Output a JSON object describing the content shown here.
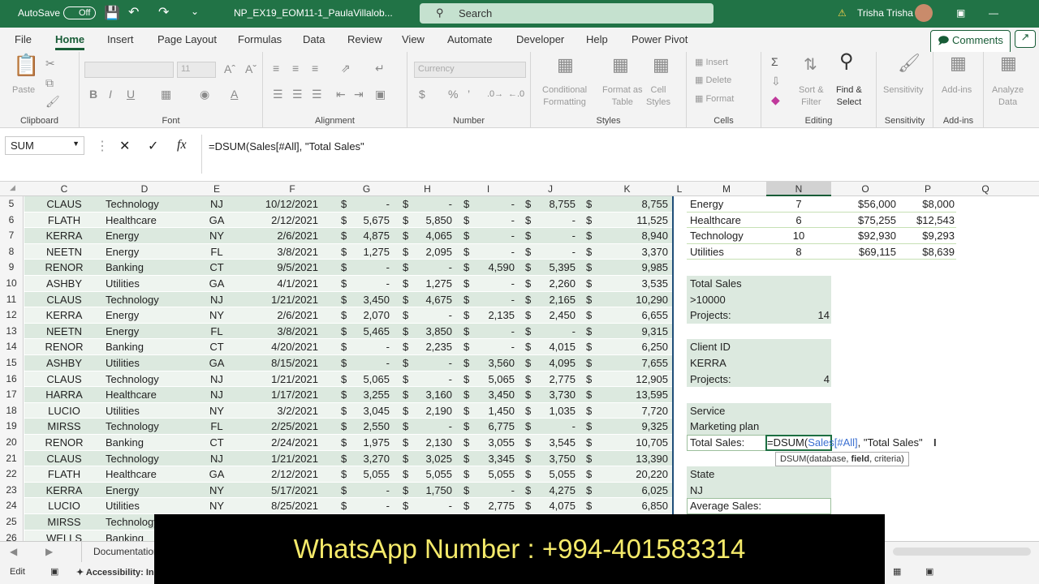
{
  "titlebar": {
    "autosave": "AutoSave",
    "toggle": "Off",
    "filename": "NP_EX19_EOM11-1_PaulaVillalob...",
    "search_placeholder": "Search",
    "user": "Trisha Trisha"
  },
  "tabs": [
    "File",
    "Home",
    "Insert",
    "Page Layout",
    "Formulas",
    "Data",
    "Review",
    "View",
    "Automate",
    "Developer",
    "Help",
    "Power Pivot"
  ],
  "active_tab": "Home",
  "comments_label": "Comments",
  "ribbon": {
    "clipboard": "Clipboard",
    "paste": "Paste",
    "font": "Font",
    "font_size": "11",
    "alignment": "Alignment",
    "number": "Number",
    "number_format": "Currency",
    "styles": "Styles",
    "cond_fmt": [
      "Conditional",
      "Formatting"
    ],
    "format_table": [
      "Format as",
      "Table"
    ],
    "cell_styles": [
      "Cell",
      "Styles"
    ],
    "cells": "Cells",
    "insert": "Insert",
    "delete": "Delete",
    "format": "Format",
    "editing": "Editing",
    "sort": [
      "Sort &",
      "Filter"
    ],
    "find": [
      "Find &",
      "Select"
    ],
    "sensitivity_grp": "Sensitivity",
    "sensitivity": "Sensitivity",
    "addins_grp": "Add-ins",
    "addins": "Add-ins",
    "analyze": [
      "Analyze",
      "Data"
    ]
  },
  "namebox": "SUM",
  "formula": "=DSUM(Sales[#All], \"Total Sales\"",
  "columns": [
    "C",
    "D",
    "E",
    "F",
    "G",
    "H",
    "I",
    "J",
    "K",
    "L",
    "M",
    "N",
    "O",
    "P",
    "Q"
  ],
  "rows": [
    {
      "n": "5",
      "c": "CLAUS",
      "d": "Technology",
      "e": "NJ",
      "f": "10/12/2021",
      "g": "-",
      "h": "-",
      "i": "-",
      "j": "8,755",
      "k": "8,755"
    },
    {
      "n": "6",
      "c": "FLATH",
      "d": "Healthcare",
      "e": "GA",
      "f": "2/12/2021",
      "g": "5,675",
      "h": "5,850",
      "i": "-",
      "j": "-",
      "k": "11,525"
    },
    {
      "n": "7",
      "c": "KERRA",
      "d": "Energy",
      "e": "NY",
      "f": "2/6/2021",
      "g": "4,875",
      "h": "4,065",
      "i": "-",
      "j": "-",
      "k": "8,940"
    },
    {
      "n": "8",
      "c": "NEETN",
      "d": "Energy",
      "e": "FL",
      "f": "3/8/2021",
      "g": "1,275",
      "h": "2,095",
      "i": "-",
      "j": "-",
      "k": "3,370"
    },
    {
      "n": "9",
      "c": "RENOR",
      "d": "Banking",
      "e": "CT",
      "f": "9/5/2021",
      "g": "-",
      "h": "-",
      "i": "4,590",
      "j": "5,395",
      "k": "9,985"
    },
    {
      "n": "10",
      "c": "ASHBY",
      "d": "Utilities",
      "e": "GA",
      "f": "4/1/2021",
      "g": "-",
      "h": "1,275",
      "i": "-",
      "j": "2,260",
      "k": "3,535"
    },
    {
      "n": "11",
      "c": "CLAUS",
      "d": "Technology",
      "e": "NJ",
      "f": "1/21/2021",
      "g": "3,450",
      "h": "4,675",
      "i": "-",
      "j": "2,165",
      "k": "10,290"
    },
    {
      "n": "12",
      "c": "KERRA",
      "d": "Energy",
      "e": "NY",
      "f": "2/6/2021",
      "g": "2,070",
      "h": "-",
      "i": "2,135",
      "j": "2,450",
      "k": "6,655"
    },
    {
      "n": "13",
      "c": "NEETN",
      "d": "Energy",
      "e": "FL",
      "f": "3/8/2021",
      "g": "5,465",
      "h": "3,850",
      "i": "-",
      "j": "-",
      "k": "9,315"
    },
    {
      "n": "14",
      "c": "RENOR",
      "d": "Banking",
      "e": "CT",
      "f": "4/20/2021",
      "g": "-",
      "h": "2,235",
      "i": "-",
      "j": "4,015",
      "k": "6,250"
    },
    {
      "n": "15",
      "c": "ASHBY",
      "d": "Utilities",
      "e": "GA",
      "f": "8/15/2021",
      "g": "-",
      "h": "-",
      "i": "3,560",
      "j": "4,095",
      "k": "7,655"
    },
    {
      "n": "16",
      "c": "CLAUS",
      "d": "Technology",
      "e": "NJ",
      "f": "1/21/2021",
      "g": "5,065",
      "h": "-",
      "i": "5,065",
      "j": "2,775",
      "k": "12,905"
    },
    {
      "n": "17",
      "c": "HARRA",
      "d": "Healthcare",
      "e": "NJ",
      "f": "1/17/2021",
      "g": "3,255",
      "h": "3,160",
      "i": "3,450",
      "j": "3,730",
      "k": "13,595"
    },
    {
      "n": "18",
      "c": "LUCIO",
      "d": "Utilities",
      "e": "NY",
      "f": "3/2/2021",
      "g": "3,045",
      "h": "2,190",
      "i": "1,450",
      "j": "1,035",
      "k": "7,720"
    },
    {
      "n": "19",
      "c": "MIRSS",
      "d": "Technology",
      "e": "FL",
      "f": "2/25/2021",
      "g": "2,550",
      "h": "-",
      "i": "6,775",
      "j": "-",
      "k": "9,325"
    },
    {
      "n": "20",
      "c": "RENOR",
      "d": "Banking",
      "e": "CT",
      "f": "2/24/2021",
      "g": "1,975",
      "h": "2,130",
      "i": "3,055",
      "j": "3,545",
      "k": "10,705"
    },
    {
      "n": "21",
      "c": "CLAUS",
      "d": "Technology",
      "e": "NJ",
      "f": "1/21/2021",
      "g": "3,270",
      "h": "3,025",
      "i": "3,345",
      "j": "3,750",
      "k": "13,390"
    },
    {
      "n": "22",
      "c": "FLATH",
      "d": "Healthcare",
      "e": "GA",
      "f": "2/12/2021",
      "g": "5,055",
      "h": "5,055",
      "i": "5,055",
      "j": "5,055",
      "k": "20,220"
    },
    {
      "n": "23",
      "c": "KERRA",
      "d": "Energy",
      "e": "NY",
      "f": "5/17/2021",
      "g": "-",
      "h": "1,750",
      "i": "-",
      "j": "4,275",
      "k": "6,025"
    },
    {
      "n": "24",
      "c": "LUCIO",
      "d": "Utilities",
      "e": "NY",
      "f": "8/25/2021",
      "g": "-",
      "h": "-",
      "i": "2,775",
      "j": "4,075",
      "k": "6,850"
    },
    {
      "n": "25",
      "c": "MIRSS",
      "d": "Technology",
      "e": "",
      "f": "",
      "g": "",
      "h": "",
      "i": "",
      "j": "",
      "k": ""
    },
    {
      "n": "26",
      "c": "WELLS",
      "d": "Banking",
      "e": "",
      "f": "",
      "g": "",
      "h": "",
      "i": "",
      "j": "",
      "k": ""
    }
  ],
  "summary": [
    {
      "m": "Energy",
      "n": "7",
      "o": "$56,000",
      "p": "$8,000"
    },
    {
      "m": "Healthcare",
      "n": "6",
      "o": "$75,255",
      "p": "$12,543"
    },
    {
      "m": "Technology",
      "n": "10",
      "o": "$92,930",
      "p": "$9,293"
    },
    {
      "m": "Utilities",
      "n": "8",
      "o": "$69,115",
      "p": "$8,639"
    }
  ],
  "criteria": {
    "r10": "Total Sales",
    "r11": ">10000",
    "r12_label": "Projects:",
    "r12_val": "14",
    "r14": "Client ID",
    "r15": "KERRA",
    "r16_label": "Projects:",
    "r16_val": "4",
    "r18": "Service",
    "r19": "Marketing plan",
    "r20_label": "Total Sales:",
    "r20_formula_a": "=DSUM(",
    "r20_formula_b": "Sales[#All]",
    "r20_formula_c": ", \"Total Sales\"",
    "r22": "State",
    "r23": "NJ",
    "r24_label": "Average Sales:"
  },
  "tooltip": {
    "a": "DSUM(database, ",
    "b": "field",
    "c": ", criteria)"
  },
  "sheet_tab": "Documentation",
  "status": {
    "mode": "Edit",
    "accessibility": "Accessibility: In"
  },
  "banner": "WhatsApp Number  : +994-401583314"
}
